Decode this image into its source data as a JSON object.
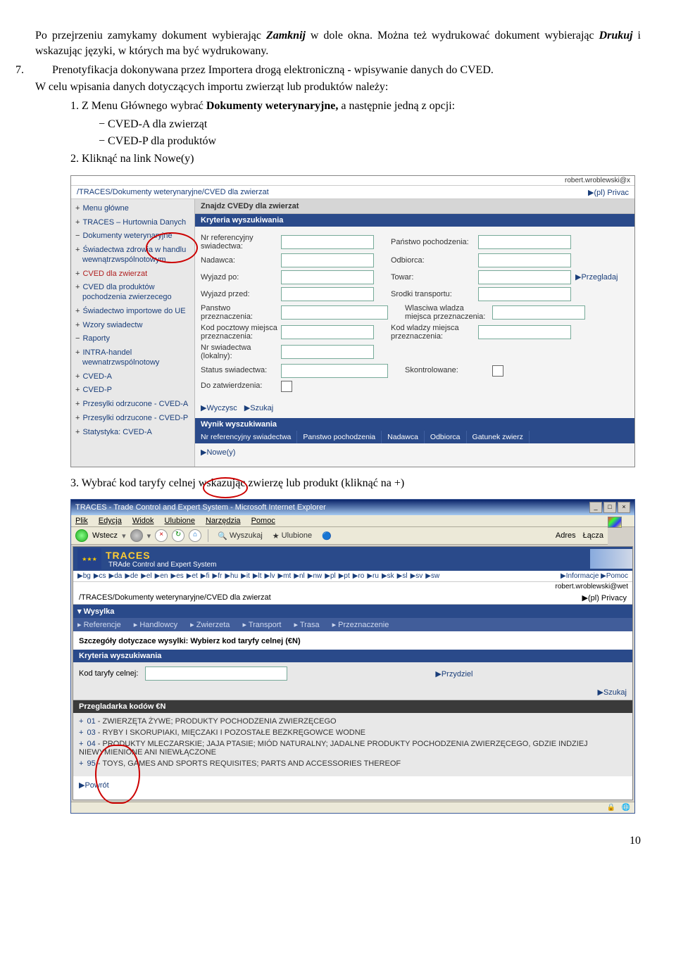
{
  "para1_a": "Po przejrzeniu zamykamy dokument wybierając ",
  "para1_zamknij": "Zamknij",
  "para1_b": " w dole okna. Można też wydrukować dokument wybierając ",
  "para1_drukuj": "Drukuj",
  "para1_c": " i wskazując języki, w których ma być wydrukowany.",
  "num7_label": "7.",
  "num7_text": "Prenotyfikacja dokonywana przez Importera drogą elektroniczną - wpisywanie danych do CVED.",
  "pre_list_text": "W celu wpisania danych dotyczących importu zwierząt lub produktów należy:",
  "li1_num": "1.",
  "li1_a": "Z Menu Głównego wybrać ",
  "li1_b": "Dokumenty weterynaryjne,",
  "li1_c": " a następnie jedną z opcji:",
  "dash1": "− CVED-A dla zwierząt",
  "dash2": "− CVED-P dla produktów",
  "li2_num": "2.",
  "li2_text": "Kliknąć na link Nowe(y)",
  "li3_num": "3.",
  "li3_text": "Wybrać kod taryfy celnej wskazując zwierzę lub produkt (kliknąć na +)",
  "page_number": "10",
  "shot1": {
    "user_right": "robert.wroblewski@x",
    "crumb": "/TRACES/Dokumenty weterynaryjne/CVED dla zwierzat",
    "crumb_right": "▶(pl) Privac",
    "sidebar": [
      "Menu główne",
      "TRACES – Hurtownia Danych",
      "Dokumenty weterynaryjne",
      "Świadectwa zdrowia w handlu wewnątrzwspólnotowym",
      "CVED dla zwierzat",
      "CVED dla produktów pochodzenia zwierzecego",
      "Świadectwo importowe do UE",
      "Wzory swiadectw",
      "Raporty",
      "INTRA-handel wewnatrzwspólnotowy",
      "CVED-A",
      "CVED-P",
      "Przesylki odrzucone - CVED-A",
      "Przesylki odrzucone - CVED-P",
      "Statystyka: CVED-A"
    ],
    "section_title": "Znajdz CVEDy dla zwierzat",
    "kryteria_hdr": "Kryteria wyszukiwania",
    "labels": {
      "nr_ref": "Nr referencyjny swiadectwa:",
      "panstwo_poch": "Państwo pochodzenia:",
      "nadawca": "Nadawca:",
      "odbiorca": "Odbiorca:",
      "wyjazd_po": "Wyjazd po:",
      "towar": "Towar:",
      "wyjazd_przed": "Wyjazd przed:",
      "srodki": "Srodki transportu:",
      "przegladaj": "▶Przegladaj",
      "panstwo_przez": "Panstwo przeznaczenia:",
      "wlasciwa": "Wlasciwa wladza miejsca przeznaczenia:",
      "kod_pocz": "Kod pocztowy miejsca przeznaczenia:",
      "kod_wladzy": "Kod wladzy miejsca przeznaczenia:",
      "nr_swiad": "Nr swiadectwa (lokalny):",
      "status": "Status swiadectwa:",
      "skontrolowane": "Skontrolowane:",
      "do_zatw": "Do zatwierdzenia:"
    },
    "wyczysc": "▶Wyczysc",
    "szukaj": "▶Szukaj",
    "wynik_hdr": "Wynik wyszukiwania",
    "cols": [
      "Nr referencyjny swiadectwa",
      "Panstwo pochodzenia",
      "Nadawca",
      "Odbiorca",
      "Gatunek zwierz"
    ],
    "nowe": "▶Nowe(y)"
  },
  "shot2": {
    "title_text": "TRACES - Trade Control and Expert System - Microsoft Internet Explorer",
    "menu": [
      "Plik",
      "Edycja",
      "Widok",
      "Ulubione",
      "Narzędzia",
      "Pomoc"
    ],
    "toolbar_back": "Wstecz",
    "toolbar_search": "Wyszukaj",
    "toolbar_fav": "Ulubione",
    "toolbar_adres": "Adres",
    "toolbar_lacza": "Łącza",
    "banner_traces": "TRACES",
    "banner_sub": "TRAde Control and Expert System",
    "langs": [
      "▶bg",
      "▶cs",
      "▶da",
      "▶de",
      "▶el",
      "▶en",
      "▶es",
      "▶et",
      "▶fi",
      "▶fr",
      "▶hu",
      "▶it",
      "▶lt",
      "▶lv",
      "▶mt",
      "▶nl",
      "▶nw",
      "▶pl",
      "▶pt",
      "▶ro",
      "▶ru",
      "▶sk",
      "▶sl",
      "▶sv",
      "▶sw"
    ],
    "lang_right_info": "▶Informacje  ▶Pomoc",
    "user": "robert.wroblewski@wet",
    "crumb": "/TRACES/Dokumenty weterynaryjne/CVED dla zwierzat",
    "crumb_right": "▶(pl) Privacy",
    "tab1": "▾ Wysylka",
    "tabs2": [
      "▸ Referencje",
      "▸ Handlowcy",
      "▸ Zwierzeta",
      "▸ Transport",
      "▸ Trasa",
      "▸ Przeznaczenie"
    ],
    "sub_title": "Szczegóły dotyczace wysylki: Wybierz kod taryfy celnej (€N)",
    "kryteria_hdr": "Kryteria wyszukiwania",
    "kod_label": "Kod taryfy celnej:",
    "przydziel": "▶Przydziel",
    "szukaj": "▶Szukaj",
    "przegladarka_hdr": "Przegladarka kodów €N",
    "cn_items": [
      {
        "code": "01",
        "text": "ZWIERZĘTA ŻYWE; PRODUKTY POCHODZENIA ZWIERZĘCEGO"
      },
      {
        "code": "03",
        "text": "RYBY I SKORUPIAKI, MIĘCZAKI I POZOSTAŁE BEZKRĘGOWCE WODNE"
      },
      {
        "code": "04",
        "text": "PRODUKTY MLECZARSKIE; JAJA PTASIE; MIÓD NATURALNY; JADALNE PRODUKTY POCHODZENIA ZWIERZĘCEGO, GDZIE INDZIEJ NIEWYMIENIONE ANI NIEWŁĄCZONE"
      },
      {
        "code": "95",
        "text": "TOYS, GAMES AND SPORTS REQUISITES; PARTS AND ACCESSORIES THEREOF"
      }
    ],
    "powrot": "▶Powrót"
  }
}
